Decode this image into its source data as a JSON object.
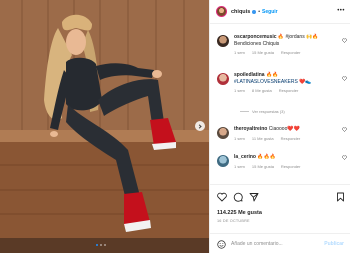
{
  "post": {
    "username": "chiquis",
    "follow_separator": "•",
    "follow_label": "Seguir",
    "more_label": "•••"
  },
  "comments": [
    {
      "username": "oscarponcemusic",
      "text": "🔥 #jordans 🙌🔥",
      "line2": "Bendiciones Chiquis",
      "time": "1 sem",
      "likes": "15 Me gusta",
      "reply": "Responder"
    },
    {
      "username": "spoiledlatina",
      "text": "🔥🔥",
      "line2": "#LATINASLOVESNEAKERS ❤️👟",
      "time": "1 sem",
      "likes": "8 Me gusta",
      "reply": "Responder",
      "view_replies": "Ver respuestas (3)"
    },
    {
      "username": "theroyaltreino",
      "text": "Ciaoooo❤️❤️",
      "time": "1 sem",
      "likes": "11 Me gusta",
      "reply": "Responder"
    },
    {
      "username": "la_cerino",
      "text": "🔥🔥🔥",
      "time": "1 sem",
      "likes": "15 Me gusta",
      "reply": "Responder"
    }
  ],
  "stats": {
    "likes": "114.225 Me gusta",
    "date": "16 DE OCTUBRE"
  },
  "composer": {
    "placeholder": "Añade un comentario...",
    "publish_label": "Publicar"
  },
  "icons": {
    "like": "heart-icon",
    "comment": "comment-icon",
    "share": "share-icon",
    "save": "bookmark-icon",
    "emoji": "emoji-icon",
    "next": "chevron-right-icon"
  },
  "carousel": {
    "count": 3,
    "active_index": 0
  },
  "colors": {
    "accent": "#0095f6",
    "verified": "#3897f0",
    "muted": "#8e8e8e"
  }
}
